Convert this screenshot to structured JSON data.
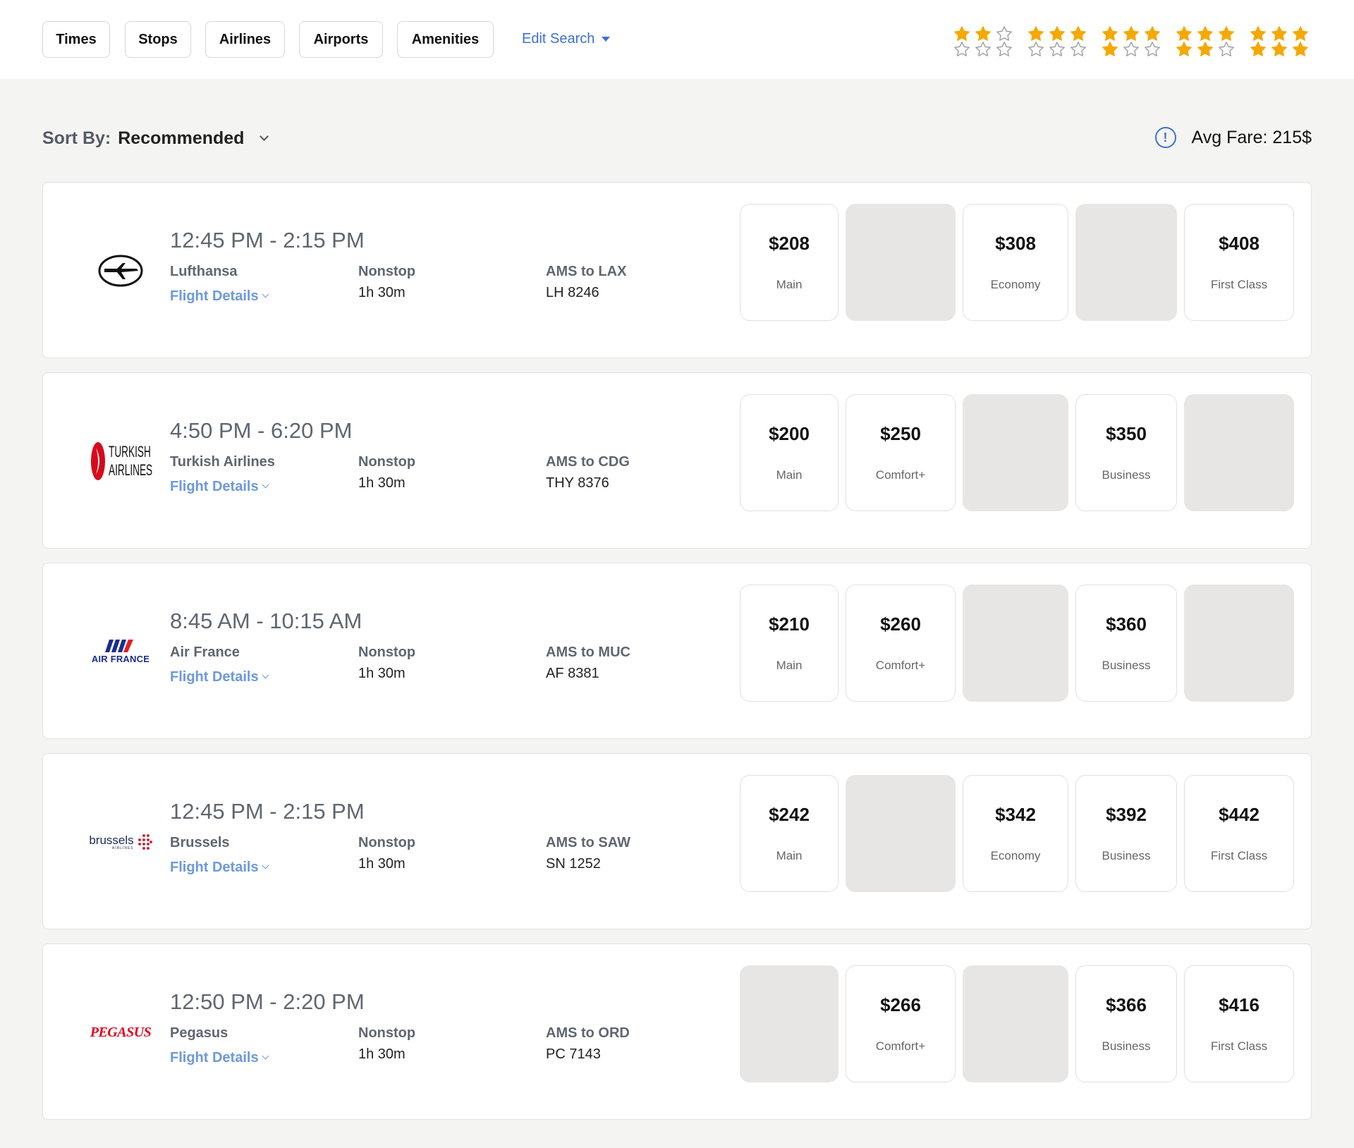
{
  "filters": [
    "Times",
    "Stops",
    "Airlines",
    "Airports",
    "Amenities"
  ],
  "edit_search": "Edit Search",
  "star_ratings": [
    {
      "top_filled": 2,
      "bottom_filled": 0
    },
    {
      "top_filled": 3,
      "bottom_filled": 0
    },
    {
      "top_filled": 3,
      "bottom_filled": 1
    },
    {
      "top_filled": 3,
      "bottom_filled": 2
    },
    {
      "top_filled": 3,
      "bottom_filled": 3
    }
  ],
  "colors": {
    "accent": "#3d6fd6",
    "star": "#f5a800",
    "empty_fare": "#e7e6e4"
  },
  "sort": {
    "label": "Sort By:",
    "value": "Recommended"
  },
  "avg_fare": {
    "text": "Avg Fare: 215$",
    "icon": "info-icon"
  },
  "flights": [
    {
      "logo": "lufthansa-logo",
      "times": "12:45 PM - 2:15 PM",
      "airline": "Lufthansa",
      "details": "Flight Details",
      "stops": "Nonstop",
      "duration": "1h 30m",
      "route": "AMS to LAX",
      "flight_no": "LH  8246",
      "fares": [
        {
          "price": "$208",
          "cls": "Main"
        },
        null,
        {
          "price": "$308",
          "cls": "Economy"
        },
        null,
        {
          "price": "$408",
          "cls": "First Class"
        }
      ]
    },
    {
      "logo": "turkish-airlines-logo",
      "logo_text": [
        "TURKISH",
        "AIRLINES"
      ],
      "times": "4:50 PM - 6:20 PM",
      "airline": "Turkish Airlines",
      "details": "Flight Details",
      "stops": "Nonstop",
      "duration": "1h 30m",
      "route": "AMS to CDG",
      "flight_no": "THY  8376",
      "fares": [
        {
          "price": "$200",
          "cls": "Main"
        },
        {
          "price": "$250",
          "cls": "Comfort+"
        },
        null,
        {
          "price": "$350",
          "cls": "Business"
        },
        null
      ]
    },
    {
      "logo": "air-france-logo",
      "logo_text": [
        "AIR FRANCE"
      ],
      "times": "8:45 AM - 10:15 AM",
      "airline": "Air France",
      "details": "Flight Details",
      "stops": "Nonstop",
      "duration": "1h 30m",
      "route": "AMS to MUC",
      "flight_no": "AF  8381",
      "fares": [
        {
          "price": "$210",
          "cls": "Main"
        },
        {
          "price": "$260",
          "cls": "Comfort+"
        },
        null,
        {
          "price": "$360",
          "cls": "Business"
        },
        null
      ]
    },
    {
      "logo": "brussels-airlines-logo",
      "logo_text": [
        "brussels",
        "AIRLINES"
      ],
      "times": "12:45 PM - 2:15 PM",
      "airline": "Brussels",
      "details": "Flight Details",
      "stops": "Nonstop",
      "duration": "1h 30m",
      "route": "AMS to SAW",
      "flight_no": "SN  1252",
      "fares": [
        {
          "price": "$242",
          "cls": "Main"
        },
        null,
        {
          "price": "$342",
          "cls": "Economy"
        },
        {
          "price": "$392",
          "cls": "Business"
        },
        {
          "price": "$442",
          "cls": "First Class"
        }
      ]
    },
    {
      "logo": "pegasus-logo",
      "logo_text": [
        "PEGASUS"
      ],
      "times": "12:50 PM - 2:20 PM",
      "airline": "Pegasus",
      "details": "Flight Details",
      "stops": "Nonstop",
      "duration": "1h 30m",
      "route": "AMS to ORD",
      "flight_no": "PC  7143",
      "fares": [
        null,
        {
          "price": "$266",
          "cls": "Comfort+"
        },
        null,
        {
          "price": "$366",
          "cls": "Business"
        },
        {
          "price": "$416",
          "cls": "First Class"
        }
      ]
    }
  ]
}
